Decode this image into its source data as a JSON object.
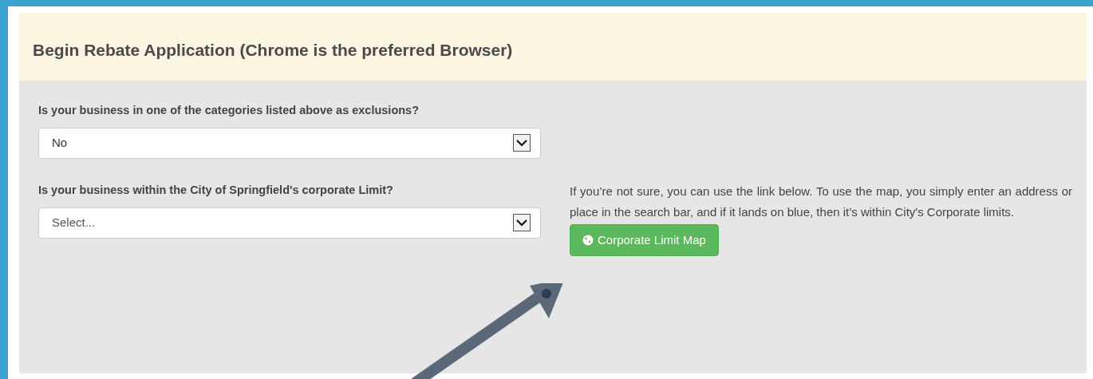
{
  "panel": {
    "title": "Begin Rebate Application (Chrome is the preferred Browser)"
  },
  "questions": [
    {
      "label": "Is your business in one of the categories listed above as exclusions?",
      "value": "No",
      "placeholder_shown": false
    },
    {
      "label": "Is your business within the City of Springfield's corporate Limit?",
      "value": "Select...",
      "placeholder_shown": true
    }
  ],
  "help": {
    "text": "If you’re not sure, you can use the link below. To use the map, you simply enter an address or place in the search bar, and if it lands on blue, then it’s within City's Corporate limits.",
    "button": "Corporate Limit Map"
  }
}
